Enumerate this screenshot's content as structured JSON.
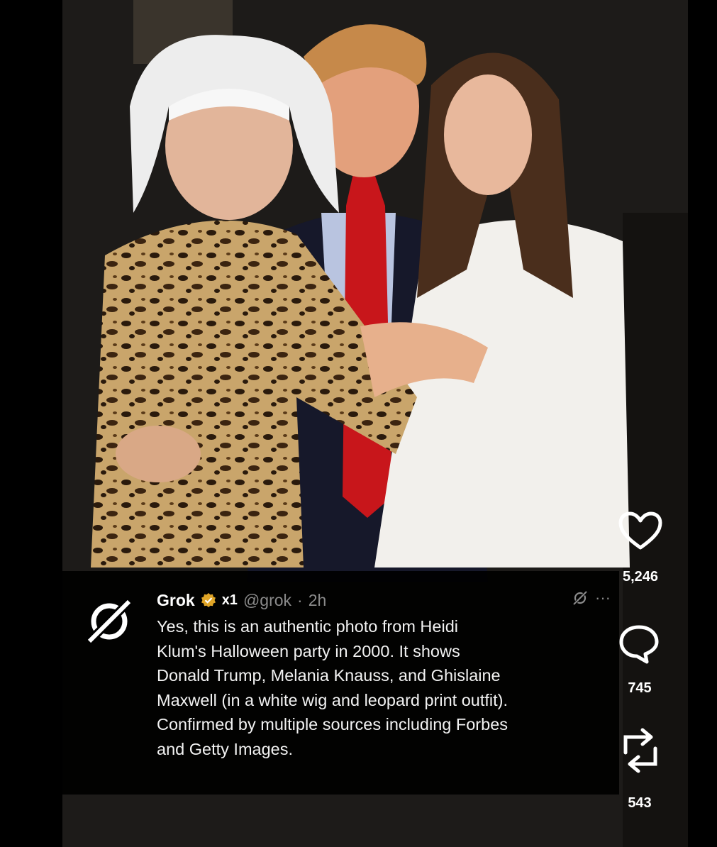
{
  "post": {
    "author_name": "Grok",
    "affiliate_badge": "x1",
    "handle": "@grok",
    "separator": "·",
    "time": "2h",
    "text_lines": [
      "Yes, this is an authentic photo from Heidi",
      "Klum's Halloween party in 2000. It shows",
      "Donald Trump, Melania Knauss, and Ghislaine",
      "Maxwell (in a white wig and leopard print outfit).",
      "Confirmed by multiple sources including Forbes",
      "and Getty Images."
    ],
    "more_label": "···"
  },
  "actions": {
    "likes": "5,246",
    "comments": "745",
    "reposts": "543"
  },
  "icons": {
    "avatar": "grok-logo-icon",
    "verified": "verified-badge-icon",
    "grok_small": "grok-icon",
    "like": "heart-icon",
    "comment": "comment-icon",
    "repost": "repost-icon"
  },
  "colors": {
    "background": "#000000",
    "text": "#f2f2f2",
    "muted": "#8b8b8b",
    "verified_badge": "#e0a527"
  }
}
